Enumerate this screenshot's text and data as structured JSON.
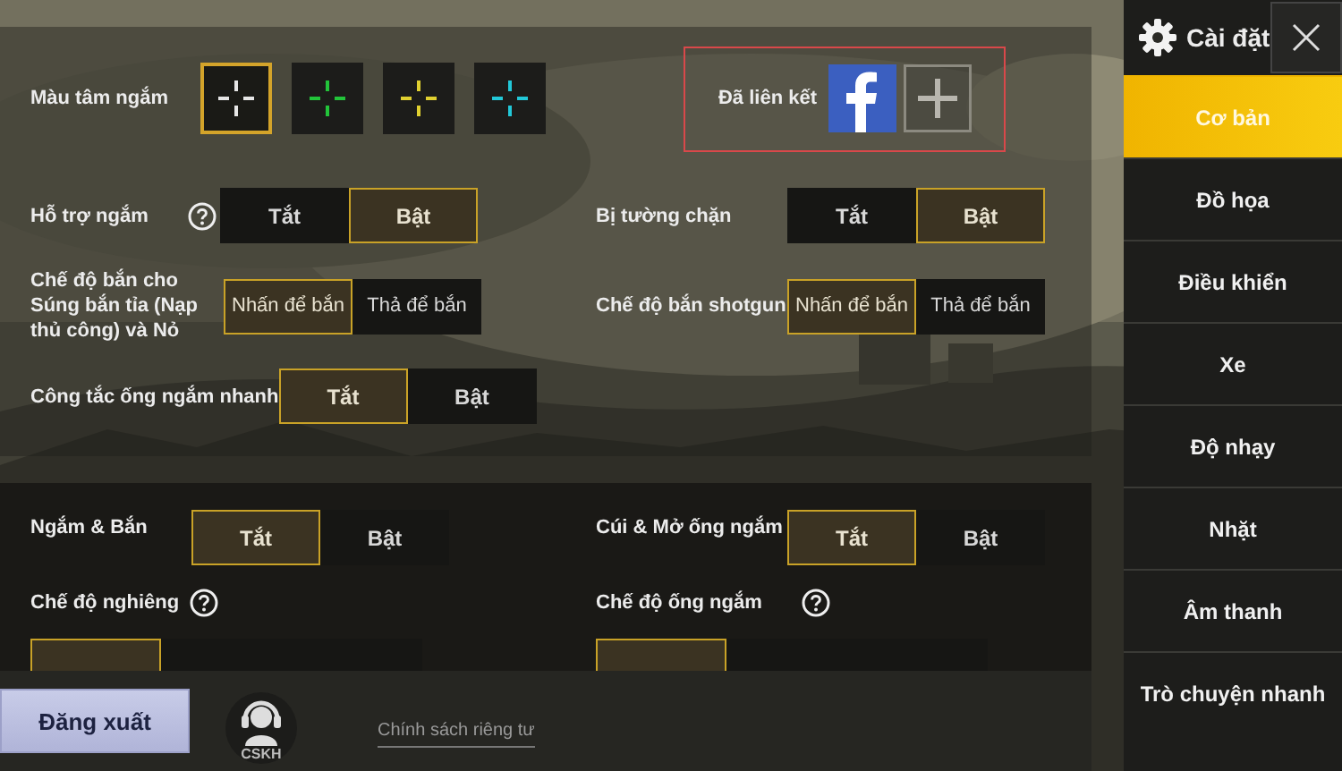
{
  "crosshair": {
    "label": "Màu tâm ngắm",
    "options": [
      {
        "color": "#e6e6e6",
        "selected": true
      },
      {
        "color": "#22c43a",
        "selected": false
      },
      {
        "color": "#e0d030",
        "selected": false
      },
      {
        "color": "#22c8d8",
        "selected": false
      }
    ]
  },
  "linked": {
    "label": "Đã liên kết"
  },
  "section1": [
    {
      "left": {
        "label": "Hỗ trợ ngắm",
        "help": true,
        "options": [
          {
            "label": "Tắt",
            "selected": false
          },
          {
            "label": "Bật",
            "selected": true
          }
        ]
      },
      "right": {
        "label": "Bị tường chặn",
        "options": [
          {
            "label": "Tắt",
            "selected": false
          },
          {
            "label": "Bật",
            "selected": true
          }
        ]
      }
    },
    {
      "left": {
        "label": "Chế độ bắn cho Súng bắn tỉa (Nạp thủ công) và Nỏ",
        "options": [
          {
            "label": "Nhấn để bắn",
            "selected": true
          },
          {
            "label": "Thả để bắn",
            "selected": false
          }
        ]
      },
      "right": {
        "label": "Chế độ bắn shotgun",
        "options": [
          {
            "label": "Nhấn để bắn",
            "selected": true
          },
          {
            "label": "Thả để bắn",
            "selected": false
          }
        ]
      }
    },
    {
      "left": {
        "label": "Công tắc ống ngắm nhanh",
        "options": [
          {
            "label": "Tắt",
            "selected": true
          },
          {
            "label": "Bật",
            "selected": false
          }
        ]
      }
    }
  ],
  "section2": [
    {
      "left": {
        "label": "Ngắm & Bắn",
        "options": [
          {
            "label": "Tắt",
            "selected": true
          },
          {
            "label": "Bật",
            "selected": false
          }
        ]
      },
      "right": {
        "label": "Cúi & Mở ống ngắm",
        "options": [
          {
            "label": "Tắt",
            "selected": true
          },
          {
            "label": "Bật",
            "selected": false
          }
        ]
      }
    },
    {
      "left": {
        "label": "Chế độ nghiêng",
        "help": true,
        "options": [
          {
            "selected": true
          },
          {
            "selected": false
          },
          {
            "selected": false
          }
        ]
      },
      "right": {
        "label": "Chế độ ống ngắm",
        "help": true,
        "options": [
          {
            "selected": true
          },
          {
            "selected": false
          },
          {
            "selected": false
          }
        ]
      }
    }
  ],
  "footer": {
    "logout": "Đăng xuất",
    "support": "CSKH",
    "privacy": "Chính sách riêng tư"
  },
  "sidebar": {
    "title": "Cài đặt",
    "items": [
      {
        "label": "Cơ bản",
        "selected": true
      },
      {
        "label": "Đồ họa",
        "selected": false
      },
      {
        "label": "Điều khiển",
        "selected": false
      },
      {
        "label": "Xe",
        "selected": false
      },
      {
        "label": "Độ nhạy",
        "selected": false
      },
      {
        "label": "Nhặt",
        "selected": false
      },
      {
        "label": "Âm thanh",
        "selected": false
      },
      {
        "label": "Trò chuyện nhanh",
        "selected": false
      }
    ]
  }
}
